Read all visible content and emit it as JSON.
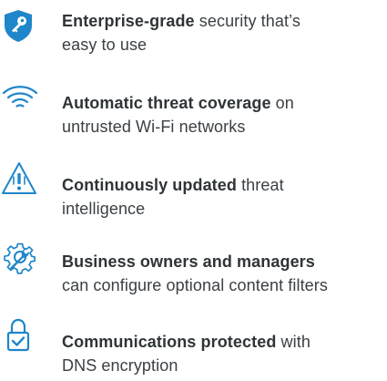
{
  "features": [
    {
      "icon": "shield-key-icon",
      "bold": "Enterprise-grade",
      "rest": " security that’s",
      "line2": "easy to use"
    },
    {
      "icon": "wifi-icon",
      "bold": "Automatic threat coverage",
      "rest": " on",
      "line2": "untrusted Wi-Fi networks"
    },
    {
      "icon": "warning-triangle-icon",
      "bold": "Continuously updated",
      "rest": " threat",
      "line2": "intelligence"
    },
    {
      "icon": "gear-wrench-icon",
      "bold": "Business owners and managers",
      "rest": "",
      "line2": "can configure optional content filters"
    },
    {
      "icon": "lock-check-icon",
      "bold": "Communications protected",
      "rest": " with",
      "line2": "DNS encryption"
    }
  ],
  "colors": {
    "icon_primary": "#1f86c9",
    "text": "#3b4044"
  }
}
